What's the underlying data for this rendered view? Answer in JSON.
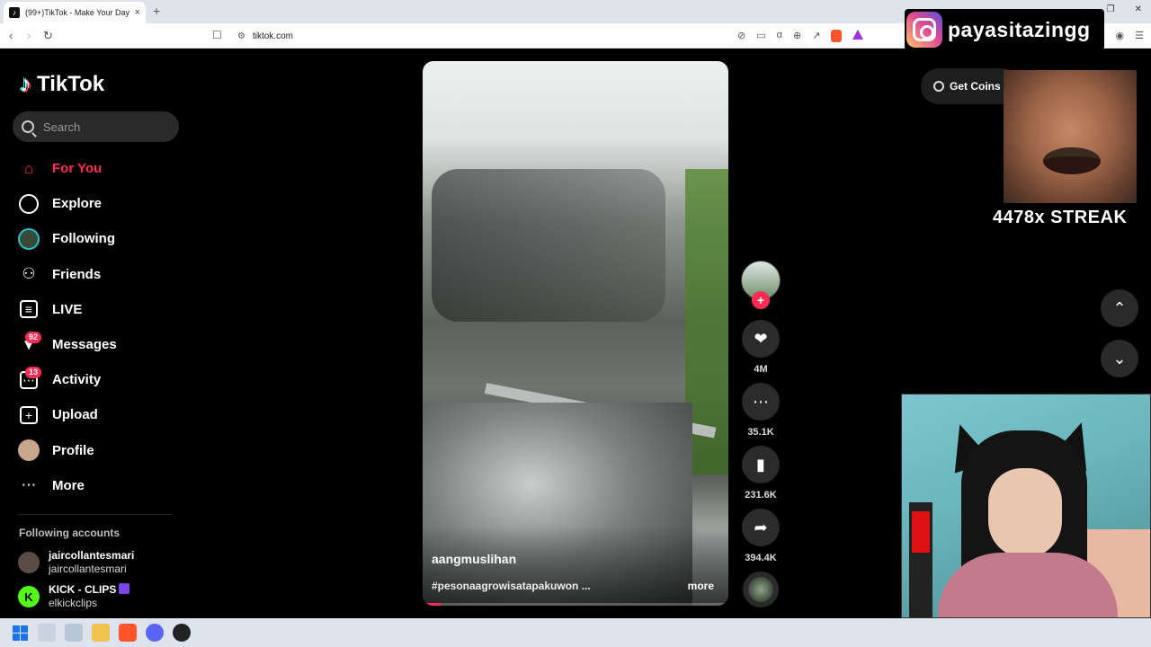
{
  "browser": {
    "tab_title": "(99+)TikTok - Make Your Day",
    "url": "tiktok.com",
    "new_tab_glyph": "+",
    "close_glyph": "×",
    "window_controls": [
      "–",
      "❐",
      "✕"
    ]
  },
  "overlay": {
    "instagram_handle": "payasitazingg",
    "get_coins": "Get Coins",
    "streak": "4478x STREAK"
  },
  "sidebar": {
    "brand": "TikTok",
    "search_placeholder": "Search",
    "items": [
      {
        "label": "For You",
        "icon": "home-icon",
        "active": true
      },
      {
        "label": "Explore",
        "icon": "compass-icon"
      },
      {
        "label": "Following",
        "icon": "following-avatar-icon"
      },
      {
        "label": "Friends",
        "icon": "friends-icon"
      },
      {
        "label": "LIVE",
        "icon": "live-tv-icon"
      },
      {
        "label": "Messages",
        "icon": "messages-icon",
        "badge": "92"
      },
      {
        "label": "Activity",
        "icon": "activity-icon",
        "badge": "13"
      },
      {
        "label": "Upload",
        "icon": "upload-icon"
      },
      {
        "label": "Profile",
        "icon": "profile-avatar-icon"
      },
      {
        "label": "More",
        "icon": "more-dots-icon"
      }
    ],
    "following_title": "Following accounts",
    "following": [
      {
        "name": "jaircollantesmari",
        "handle": "jaircollantesmari"
      },
      {
        "name": "KICK - CLIPS",
        "handle": "elkickclips",
        "avatar_letter": "K"
      }
    ]
  },
  "video": {
    "author": "aangmuslihan",
    "caption": "#pesonaagrowisatapakuwon ...",
    "more": "more",
    "progress": 0.06
  },
  "actions": {
    "follow_plus": "+",
    "likes": "4M",
    "comments": "35.1K",
    "saves": "231.6K",
    "shares": "394.4K"
  },
  "colors": {
    "accent": "#fe2c55",
    "cyan": "#25f4ee",
    "kick_green": "#53fc18"
  }
}
